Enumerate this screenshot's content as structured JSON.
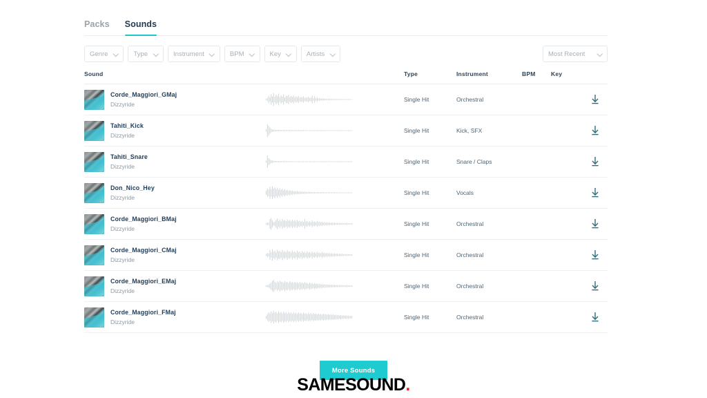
{
  "tabs": [
    {
      "label": "Packs",
      "active": false
    },
    {
      "label": "Sounds",
      "active": true
    }
  ],
  "filters": [
    {
      "label": "Genre"
    },
    {
      "label": "Type"
    },
    {
      "label": "Instrument"
    },
    {
      "label": "BPM"
    },
    {
      "label": "Key"
    },
    {
      "label": "Artists"
    }
  ],
  "sort": {
    "label": "Most Recent"
  },
  "table": {
    "headers": {
      "sound": "Sound",
      "wave": "",
      "type": "Type",
      "instrument": "Instrument",
      "bpm": "BPM",
      "key": "Key",
      "download": ""
    },
    "rows": [
      {
        "title": "Corde_Maggiori_GMaj",
        "artist": "Dizzyride",
        "type": "Single Hit",
        "instrument": "Orchestral",
        "bpm": "",
        "key": "",
        "download_icon": "download-icon"
      },
      {
        "title": "Tahiti_Kick",
        "artist": "Dizzyride",
        "type": "Single Hit",
        "instrument": "Kick, SFX",
        "bpm": "",
        "key": "",
        "download_icon": "download-icon"
      },
      {
        "title": "Tahiti_Snare",
        "artist": "Dizzyride",
        "type": "Single Hit",
        "instrument": "Snare / Claps",
        "bpm": "",
        "key": "",
        "download_icon": "download-icon"
      },
      {
        "title": "Don_Nico_Hey",
        "artist": "Dizzyride",
        "type": "Single Hit",
        "instrument": "Vocals",
        "bpm": "",
        "key": "",
        "download_icon": "download-icon"
      },
      {
        "title": "Corde_Maggiori_BMaj",
        "artist": "Dizzyride",
        "type": "Single Hit",
        "instrument": "Orchestral",
        "bpm": "",
        "key": "",
        "download_icon": "download-icon"
      },
      {
        "title": "Corde_Maggiori_CMaj",
        "artist": "Dizzyride",
        "type": "Single Hit",
        "instrument": "Orchestral",
        "bpm": "",
        "key": "",
        "download_icon": "download-icon"
      },
      {
        "title": "Corde_Maggiori_EMaj",
        "artist": "Dizzyride",
        "type": "Single Hit",
        "instrument": "Orchestral",
        "bpm": "",
        "key": "",
        "download_icon": "download-icon"
      },
      {
        "title": "Corde_Maggiori_FMaj",
        "artist": "Dizzyride",
        "type": "Single Hit",
        "instrument": "Orchestral",
        "bpm": "",
        "key": "",
        "download_icon": "download-icon"
      }
    ]
  },
  "waveforms": [
    [
      0.1,
      0.22,
      0.55,
      0.3,
      0.75,
      0.45,
      0.92,
      0.4,
      0.7,
      0.52,
      0.85,
      0.35,
      0.6,
      0.42,
      0.74,
      0.3,
      0.55,
      0.48,
      0.66,
      0.33,
      0.5,
      0.4,
      0.58,
      0.28,
      0.44,
      0.35,
      0.52,
      0.26,
      0.38,
      0.3,
      0.45,
      0.22,
      0.34,
      0.26,
      0.4,
      0.18,
      0.3,
      0.55,
      0.2,
      0.48,
      0.16,
      0.3,
      0.14,
      0.22,
      0.12,
      0.18,
      0.1,
      0.16,
      0.09,
      0.14,
      0.08,
      0.12,
      0.08,
      0.1,
      0.07,
      0.09,
      0.07,
      0.08,
      0.06,
      0.08,
      0.06,
      0.07,
      0.06,
      0.07,
      0.06,
      0.06,
      0.06,
      0.06,
      0.06,
      0.06
    ],
    [
      0.18,
      0.95,
      0.7,
      0.45,
      0.26,
      0.18,
      0.14,
      0.12,
      0.11,
      0.1,
      0.09,
      0.09,
      0.08,
      0.08,
      0.08,
      0.07,
      0.09,
      0.07,
      0.08,
      0.07,
      0.09,
      0.07,
      0.08,
      0.07,
      0.09,
      0.07,
      0.08,
      0.07,
      0.08,
      0.07,
      0.07,
      0.07,
      0.07,
      0.06,
      0.06,
      0.06,
      0.06,
      0.06,
      0.06,
      0.06,
      0.07,
      0.06,
      0.08,
      0.06,
      0.07,
      0.06,
      0.06,
      0.06,
      0.06,
      0.06,
      0.06,
      0.06,
      0.06,
      0.06,
      0.06,
      0.06,
      0.06,
      0.06,
      0.06,
      0.06,
      0.06,
      0.06,
      0.06,
      0.06,
      0.06,
      0.06,
      0.06,
      0.06,
      0.06,
      0.06
    ],
    [
      0.16,
      0.9,
      0.52,
      0.34,
      0.22,
      0.16,
      0.13,
      0.11,
      0.1,
      0.09,
      0.09,
      0.08,
      0.08,
      0.08,
      0.07,
      0.07,
      0.07,
      0.07,
      0.07,
      0.07,
      0.07,
      0.06,
      0.06,
      0.06,
      0.06,
      0.06,
      0.06,
      0.06,
      0.06,
      0.06,
      0.06,
      0.06,
      0.06,
      0.06,
      0.06,
      0.06,
      0.06,
      0.06,
      0.06,
      0.06,
      0.06,
      0.06,
      0.06,
      0.06,
      0.06,
      0.06,
      0.06,
      0.06,
      0.06,
      0.06,
      0.06,
      0.06,
      0.06,
      0.06,
      0.06,
      0.06,
      0.06,
      0.06,
      0.06,
      0.06,
      0.06,
      0.06,
      0.06,
      0.06,
      0.06,
      0.06,
      0.06,
      0.06,
      0.06,
      0.06
    ],
    [
      0.3,
      0.62,
      0.48,
      0.88,
      0.54,
      0.92,
      0.6,
      0.8,
      0.52,
      0.74,
      0.46,
      0.66,
      0.4,
      0.58,
      0.36,
      0.5,
      0.32,
      0.44,
      0.28,
      0.38,
      0.24,
      0.32,
      0.2,
      0.27,
      0.18,
      0.23,
      0.16,
      0.2,
      0.14,
      0.18,
      0.12,
      0.16,
      0.11,
      0.14,
      0.1,
      0.13,
      0.09,
      0.12,
      0.09,
      0.11,
      0.08,
      0.1,
      0.08,
      0.09,
      0.08,
      0.09,
      0.07,
      0.08,
      0.07,
      0.08,
      0.07,
      0.07,
      0.07,
      0.07,
      0.07,
      0.07,
      0.06,
      0.07,
      0.06,
      0.06,
      0.06,
      0.06,
      0.06,
      0.06,
      0.06,
      0.06,
      0.06,
      0.06,
      0.06,
      0.06
    ],
    [
      0.12,
      0.2,
      0.16,
      0.7,
      0.85,
      0.52,
      0.26,
      0.34,
      0.55,
      0.78,
      0.44,
      0.62,
      0.36,
      0.72,
      0.48,
      0.58,
      0.4,
      0.66,
      0.44,
      0.56,
      0.35,
      0.62,
      0.42,
      0.5,
      0.33,
      0.58,
      0.38,
      0.48,
      0.3,
      0.44,
      0.26,
      0.7,
      0.34,
      0.42,
      0.26,
      0.38,
      0.24,
      0.5,
      0.28,
      0.36,
      0.22,
      0.44,
      0.26,
      0.34,
      0.2,
      0.3,
      0.18,
      0.26,
      0.16,
      0.24,
      0.14,
      0.22,
      0.13,
      0.2,
      0.12,
      0.18,
      0.11,
      0.16,
      0.1,
      0.15,
      0.1,
      0.14,
      0.09,
      0.13,
      0.09,
      0.12,
      0.08,
      0.11,
      0.08,
      0.1
    ],
    [
      0.14,
      0.3,
      0.22,
      0.72,
      0.38,
      0.84,
      0.46,
      0.64,
      0.36,
      0.78,
      0.5,
      0.6,
      0.4,
      0.74,
      0.44,
      0.56,
      0.38,
      0.7,
      0.46,
      0.54,
      0.34,
      0.66,
      0.42,
      0.52,
      0.32,
      0.62,
      0.4,
      0.5,
      0.3,
      0.58,
      0.36,
      0.46,
      0.28,
      0.54,
      0.34,
      0.44,
      0.26,
      0.5,
      0.3,
      0.4,
      0.24,
      0.46,
      0.28,
      0.36,
      0.22,
      0.42,
      0.26,
      0.34,
      0.2,
      0.32,
      0.18,
      0.28,
      0.17,
      0.26,
      0.15,
      0.24,
      0.14,
      0.22,
      0.13,
      0.2,
      0.12,
      0.18,
      0.11,
      0.16,
      0.1,
      0.14,
      0.1,
      0.13,
      0.09,
      0.12
    ],
    [
      0.1,
      0.14,
      0.22,
      0.36,
      0.54,
      0.74,
      0.88,
      0.62,
      0.46,
      0.7,
      0.52,
      0.8,
      0.58,
      0.66,
      0.48,
      0.74,
      0.54,
      0.62,
      0.44,
      0.7,
      0.5,
      0.58,
      0.42,
      0.64,
      0.46,
      0.54,
      0.38,
      0.6,
      0.44,
      0.5,
      0.36,
      0.56,
      0.4,
      0.46,
      0.32,
      0.5,
      0.36,
      0.42,
      0.28,
      0.44,
      0.3,
      0.38,
      0.26,
      0.34,
      0.22,
      0.3,
      0.2,
      0.26,
      0.18,
      0.24,
      0.16,
      0.22,
      0.15,
      0.2,
      0.14,
      0.18,
      0.13,
      0.17,
      0.12,
      0.16,
      0.11,
      0.15,
      0.1,
      0.14,
      0.1,
      0.13,
      0.09,
      0.12,
      0.09,
      0.11
    ],
    [
      0.2,
      0.46,
      0.7,
      0.52,
      0.86,
      0.6,
      0.92,
      0.66,
      0.78,
      0.56,
      0.84,
      0.62,
      0.74,
      0.54,
      0.8,
      0.58,
      0.7,
      0.5,
      0.76,
      0.56,
      0.68,
      0.48,
      0.72,
      0.54,
      0.64,
      0.46,
      0.7,
      0.52,
      0.62,
      0.44,
      0.66,
      0.5,
      0.58,
      0.42,
      0.62,
      0.46,
      0.56,
      0.4,
      0.58,
      0.44,
      0.52,
      0.38,
      0.54,
      0.4,
      0.48,
      0.36,
      0.5,
      0.38,
      0.46,
      0.34,
      0.44,
      0.32,
      0.42,
      0.3,
      0.4,
      0.28,
      0.36,
      0.26,
      0.34,
      0.24,
      0.3,
      0.22,
      0.28,
      0.2,
      0.26,
      0.18,
      0.24,
      0.17,
      0.22,
      0.16
    ]
  ],
  "footer": {
    "more_button": "More Sounds",
    "brand": "SAMESOUND",
    "brand_dot": "."
  },
  "colors": {
    "accent_teal": "#1ecbd0",
    "brand_dot_red": "#e8231f",
    "title_navy": "#1f3b57"
  }
}
